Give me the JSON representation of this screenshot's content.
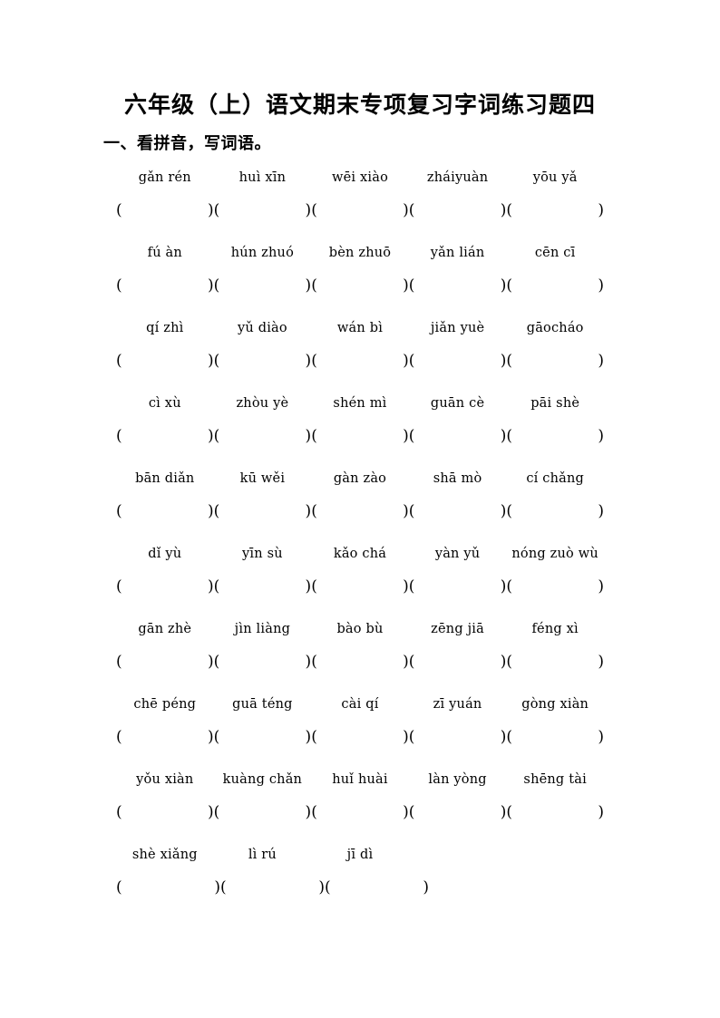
{
  "document": {
    "title": "六年级（上）语文期末专项复习字词练习题四",
    "section_heading": "一、看拼音，写词语。",
    "paren_open": "(",
    "paren_close": ")"
  },
  "exercise": {
    "rows": [
      {
        "items": [
          "gǎn rén",
          "huì xīn",
          "wēi xiào",
          "zháiyuàn",
          "yōu yǎ"
        ]
      },
      {
        "items": [
          "fú àn",
          "hún zhuó",
          "bèn zhuō",
          "yǎn lián",
          "cēn cī"
        ]
      },
      {
        "items": [
          "qí zhì",
          "yǔ diào",
          "wán bì",
          "jiǎn yuè",
          "gāocháo"
        ]
      },
      {
        "items": [
          "cì xù",
          "zhòu yè",
          "shén mì",
          "guān cè",
          "pāi shè"
        ]
      },
      {
        "items": [
          "bān diǎn",
          "kū wěi",
          "gàn zào",
          "shā mò",
          "cí chǎng"
        ]
      },
      {
        "items": [
          "dǐ yù",
          "yīn sù",
          "kǎo chá",
          "yàn yǔ",
          "nóng zuò wù"
        ]
      },
      {
        "items": [
          "gān zhè",
          "jìn liàng",
          "bào bù",
          "zēng jiā",
          "féng xì"
        ]
      },
      {
        "items": [
          "chē péng",
          "guā téng",
          "cài qí",
          "zī yuán",
          "gòng xiàn"
        ]
      },
      {
        "items": [
          "yǒu xiàn",
          "kuàng chǎn",
          "huǐ huài",
          "làn yòng",
          "shēng tài"
        ]
      },
      {
        "items": [
          "shè xiǎng",
          "lì rú",
          "jī dì"
        ]
      }
    ]
  }
}
